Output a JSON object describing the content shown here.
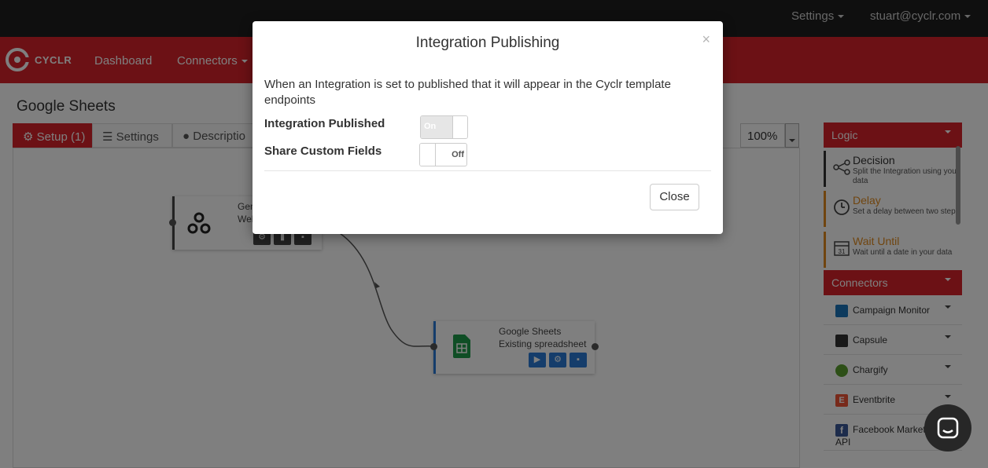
{
  "topbar": {
    "settings_label": "Settings",
    "user_label": "stuart@cyclr.com"
  },
  "navbar": {
    "brand": "CYCLR",
    "links": [
      "Dashboard",
      "Connectors"
    ]
  },
  "page": {
    "title": "Google Sheets",
    "tabs": [
      {
        "label": "Setup (1)",
        "icon": "gear-icon",
        "active": true
      },
      {
        "label": "Settings",
        "icon": "sliders-icon",
        "active": false
      },
      {
        "label": "Descriptio",
        "icon": "comment-icon",
        "active": false
      }
    ],
    "zoom": "100%"
  },
  "canvas": {
    "nodes": [
      {
        "label_line1": "Gen",
        "label_line2": "Web",
        "icon": "webhook-icon",
        "accent": "#444444"
      },
      {
        "label_line1": "Google Sheets",
        "label_line2": "Existing spreadsheet",
        "icon": "google-sheets-icon",
        "accent": "#2a7bd6"
      }
    ]
  },
  "logic_panel": {
    "header": "Logic",
    "items": [
      {
        "title": "Decision",
        "desc": "Split the Integration using your data",
        "icon": "decision-icon",
        "accent": "#333333"
      },
      {
        "title": "Delay",
        "desc": "Set a delay between two steps",
        "icon": "clock-icon",
        "accent": "#e08a1e"
      },
      {
        "title": "Wait Until",
        "desc": "Wait until a date in your data",
        "icon": "calendar-icon",
        "accent": "#e08a1e",
        "calendar_day": "31"
      }
    ]
  },
  "connectors_panel": {
    "header": "Connectors",
    "items": [
      {
        "label": "Campaign Monitor",
        "icon": "campaign-monitor-icon",
        "color": "#1b75bb"
      },
      {
        "label": "Capsule",
        "icon": "capsule-icon",
        "color": "#333333"
      },
      {
        "label": "Chargify",
        "icon": "chargify-icon",
        "color": "#5a9e2f"
      },
      {
        "label": "Eventbrite",
        "icon": "eventbrite-icon",
        "color": "#f05537",
        "glyph": "E"
      },
      {
        "label": "Facebook Market",
        "label2": "API",
        "icon": "facebook-icon",
        "color": "#3b5998",
        "glyph": "f"
      }
    ]
  },
  "modal": {
    "title": "Integration Publishing",
    "close_glyph": "×",
    "description": "When an Integration is set to published that it will appear in the Cyclr template endpoints",
    "fields": [
      {
        "label": "Integration Published",
        "state": "On"
      },
      {
        "label": "Share Custom Fields",
        "state": "Off"
      }
    ],
    "close_button": "Close"
  }
}
